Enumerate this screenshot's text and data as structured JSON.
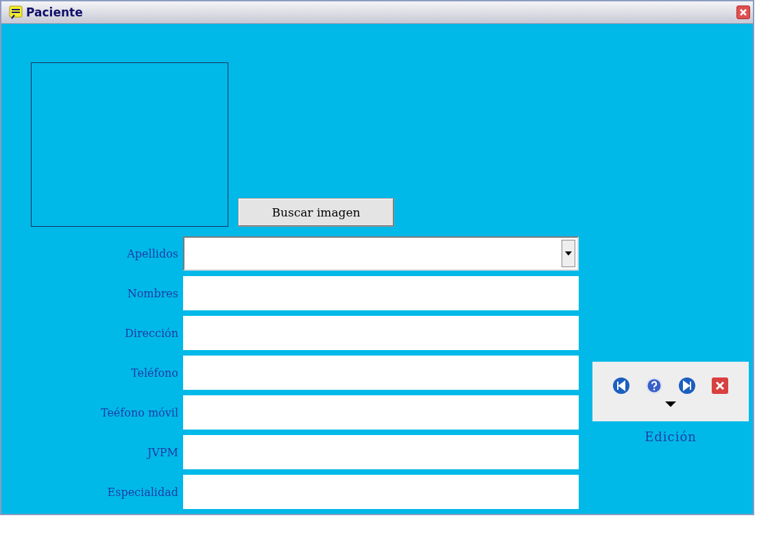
{
  "window": {
    "title": "Paciente"
  },
  "photo_button": "Buscar imagen",
  "fields": [
    {
      "label": "Apellidos",
      "kind": "dropdown"
    },
    {
      "label": "Nombres",
      "kind": "text"
    },
    {
      "label": "Dirección",
      "kind": "text"
    },
    {
      "label": "Teléfono",
      "kind": "text"
    },
    {
      "label": "Teéfono móvil",
      "kind": "text"
    },
    {
      "label": "JVPM",
      "kind": "text"
    },
    {
      "label": "Especialidad",
      "kind": "text"
    }
  ],
  "toolbar": {
    "label": "Edición"
  }
}
